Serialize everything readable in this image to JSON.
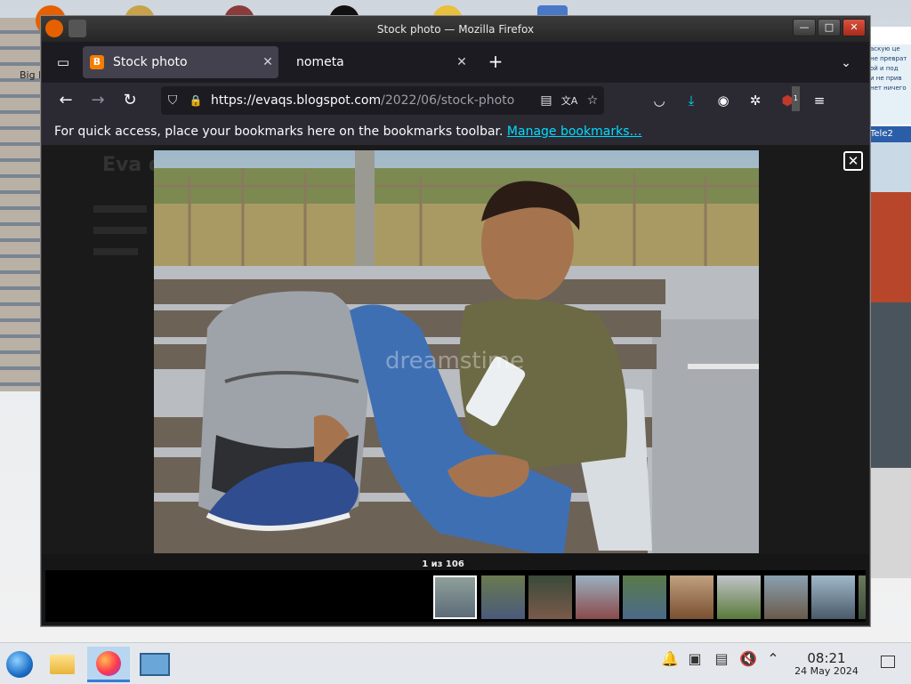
{
  "desktop": {
    "icon_label": "Big De",
    "right_sign_text": "аскую це\nне преврат\nой и под\nи не прив\nнет ничего",
    "right_brand": "Tele2"
  },
  "window": {
    "title": "Stock photo — Mozilla Firefox",
    "controls": {
      "minimize": "—",
      "maximize": "□",
      "close": "✕"
    }
  },
  "tabs": [
    {
      "label": "Stock photo",
      "favicon": "B",
      "close": "✕",
      "active": true
    },
    {
      "label": "nometa",
      "close": "✕",
      "active": false
    }
  ],
  "tabstrip": {
    "new_tab": "+",
    "list_all": "⌄",
    "tab_list_icon": "▭"
  },
  "navbar": {
    "back": "←",
    "forward": "→",
    "reload": "↻",
    "url_host": "https://evaqs.blogspot.com",
    "url_path": "/2022/06/stock-photo",
    "url_icons": {
      "shield": "⛉",
      "lock": "🔒",
      "reader": "▤",
      "translate": "文A",
      "bookmark": "☆"
    },
    "toolbar_icons": {
      "pocket": "◡",
      "downloads": "⤓",
      "account": "◉",
      "extensions": "✲",
      "ublock_badge": "1",
      "menu": "≡"
    }
  },
  "bookmarks_bar": {
    "text": "For quick access, place your bookmarks here on the bookmarks toolbar.",
    "link": "Manage bookmarks…"
  },
  "page": {
    "title_behind": "Eva q"
  },
  "lightbox": {
    "close": "✕",
    "counter": "1 из 106",
    "watermark": "dreamstime",
    "thumbnails_count": 10
  },
  "taskbar": {
    "time": "08:21",
    "date": "24 May 2024",
    "tray_icons": [
      "bell-icon",
      "network-icon",
      "clipboard-icon",
      "mute-icon",
      "chevron-up-icon"
    ]
  },
  "colors": {
    "accent": "#00ddff",
    "tab_active": "#42414d",
    "toolbar": "#2b2a33",
    "frame": "#1c1b22"
  }
}
